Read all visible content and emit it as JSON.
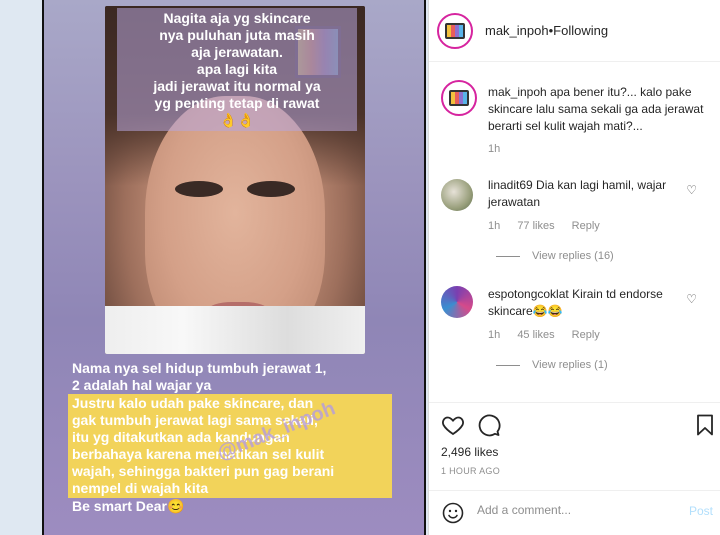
{
  "story": {
    "top_caption": [
      "Nagita aja yg skincare",
      "nya puluhan juta masih",
      "aja jerawatan.",
      "apa lagi kita",
      "jadi jerawat itu normal ya",
      "yg penting tetap di rawat"
    ],
    "top_emoji": "👌👌",
    "plain_lines": [
      "Nama nya sel hidup tumbuh jerawat 1,",
      "2 adalah hal wajar ya"
    ],
    "highlight_lines": [
      "Justru kalo udah pake skincare, dan",
      "gak tumbuh jerawat lagi sama sekali,",
      "itu yg ditakutkan ada kandungan",
      "berbahaya karena mematikan sel kulit",
      "wajah, sehingga bakteri pun gag berani",
      "nempel di wajah kita"
    ],
    "closing": "Be smart Dear😊",
    "watermark": "@mak_inpoh"
  },
  "header": {
    "username": "mak_inpoh",
    "separator": " • ",
    "follow_status": "Following"
  },
  "caption": {
    "username": "mak_inpoh",
    "text": "apa bener itu?... kalo pake skincare lalu sama sekali ga ada jerawat berarti sel kulit wajah mati?...",
    "time": "1h"
  },
  "comments": [
    {
      "username": "linadit69",
      "text": "Dia kan lagi hamil, wajar jerawatan",
      "time": "1h",
      "likes": "77 likes",
      "reply": "Reply",
      "view_replies": "View replies (16)"
    },
    {
      "username": "espotongcoklat",
      "text": "Kirain td endorse skincare😂😂",
      "time": "1h",
      "likes": "45 likes",
      "reply": "Reply",
      "view_replies": "View replies (1)"
    }
  ],
  "actions": {
    "likes": "2,496 likes",
    "time_ago": "1 HOUR AGO"
  },
  "add_comment": {
    "placeholder": "Add a comment...",
    "post_label": "Post"
  },
  "colors": {
    "ring": "#d6249f",
    "muted": "#8e8e8e",
    "post_disabled": "#b2dffc",
    "highlight": "#f2d35a"
  }
}
